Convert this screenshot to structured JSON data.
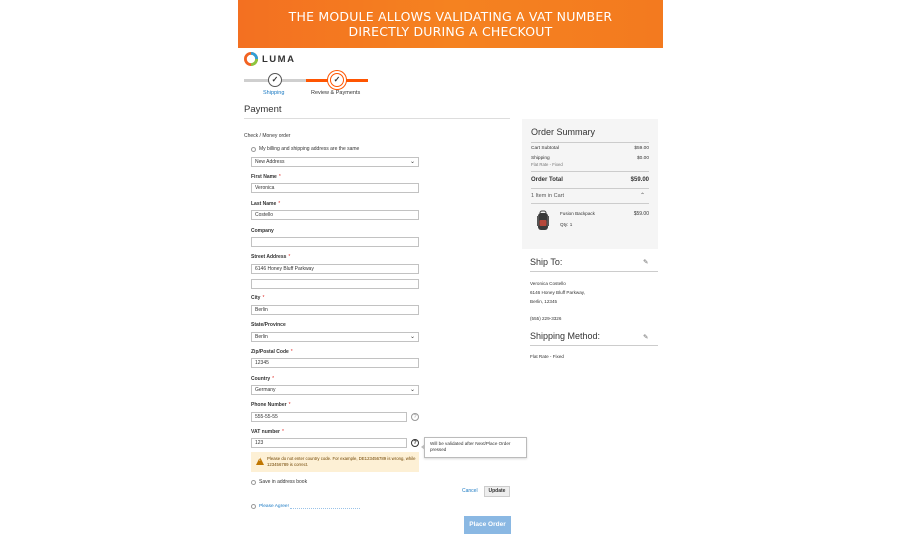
{
  "banner": {
    "line1": "THE MODULE ALLOWS VALIDATING A VAT NUMBER",
    "line2": "DIRECTLY DURING A CHECKOUT"
  },
  "logo": {
    "text": "LUMA"
  },
  "progress": {
    "steps": [
      {
        "label": "Shipping",
        "state": "complete"
      },
      {
        "label": "Review & Payments",
        "state": "active"
      }
    ]
  },
  "payment": {
    "title": "Payment",
    "method_label": "Check / Money order",
    "same_address_label": "My billing and shipping address are the same",
    "address_select": "New Address",
    "fields": {
      "first_name": {
        "label": "First Name",
        "value": "Veronica"
      },
      "last_name": {
        "label": "Last Name",
        "value": "Costello"
      },
      "company": {
        "label": "Company",
        "value": ""
      },
      "street": {
        "label": "Street Address",
        "value": "6146 Honey Bluff Parkway",
        "value2": ""
      },
      "city": {
        "label": "City",
        "value": "Berlin"
      },
      "state": {
        "label": "State/Province",
        "value": "Berlin"
      },
      "zip": {
        "label": "Zip/Postal Code",
        "value": "12345"
      },
      "country": {
        "label": "Country",
        "value": "Germany"
      },
      "phone": {
        "label": "Phone Number",
        "value": "555-55-55"
      },
      "vat": {
        "label": "VAT number",
        "value": "123"
      }
    },
    "required_mark": "*",
    "help_mark": "?",
    "vat_tooltip": "Will be validated after Next/Place Order pressed",
    "vat_warning": "Please do not enter country code. For example, DE123456789 is wrong, while 123456789 is correct.",
    "save_address_label": "Save in address book",
    "cancel_label": "Cancel",
    "update_label": "Update",
    "agreement_label": "Please Agree!",
    "place_order_label": "Place Order"
  },
  "summary": {
    "title": "Order Summary",
    "cart_subtotal_label": "Cart Subtotal",
    "cart_subtotal_value": "$59.00",
    "shipping_label": "Shipping",
    "shipping_sub": "Flat Rate - Fixed",
    "shipping_value": "$0.00",
    "order_total_label": "Order Total",
    "order_total_value": "$59.00",
    "items_in_cart": "1 Item in Cart",
    "items": [
      {
        "name": "Fusion Backpack",
        "qty": "Qty: 1",
        "price": "$59.00"
      }
    ]
  },
  "ship_to": {
    "title": "Ship To:",
    "name": "Veronica Costello",
    "street": "6146 Honey Bluff Parkway,",
    "city_zip": "Berlin, 12345",
    "phone": "(555) 229-3326"
  },
  "shipping_method": {
    "title": "Shipping Method:",
    "value": "Flat Rate - Fixed"
  },
  "colors": {
    "banner": "#f37021",
    "progress_active": "#ff5501",
    "link": "#1979c3",
    "place_order": "#8ab8e3",
    "warning_bg": "#fdf0d5"
  }
}
